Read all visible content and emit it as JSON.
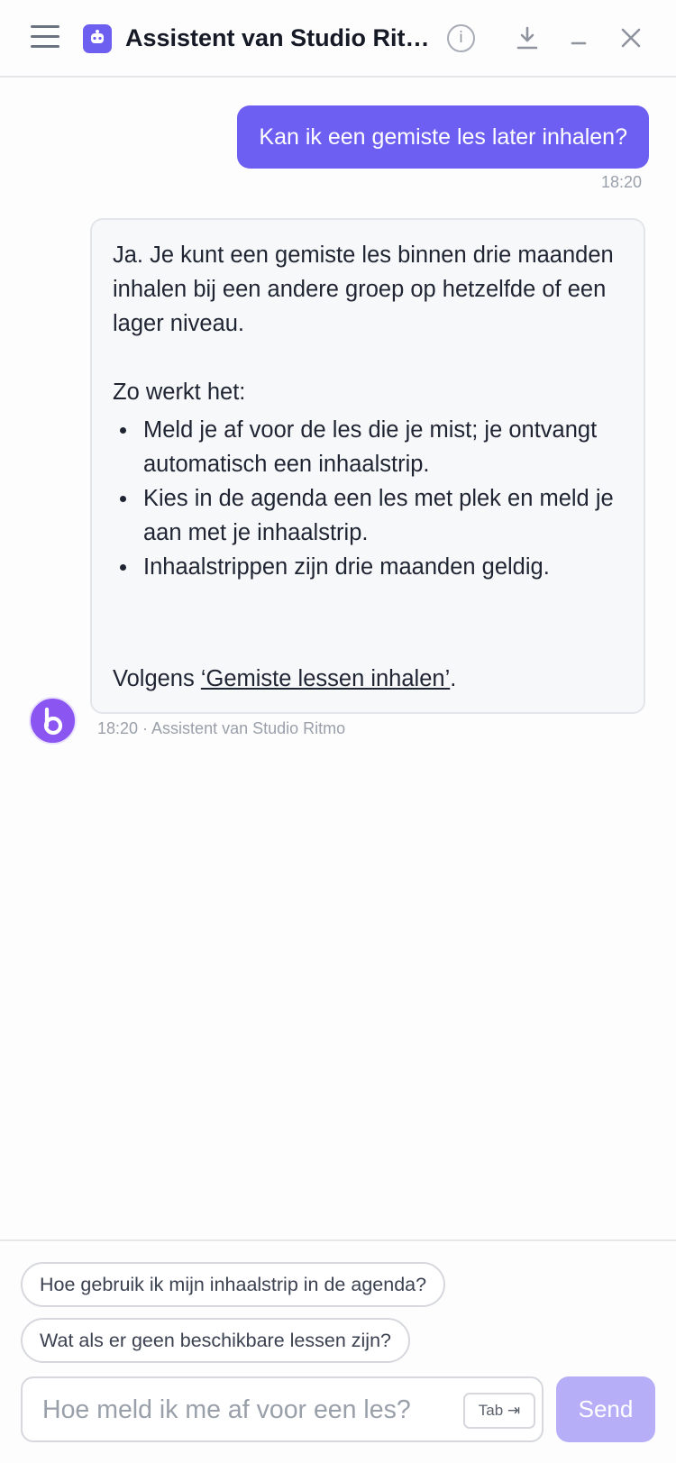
{
  "header": {
    "title": "Assistent van Studio Ritmo",
    "info_label": "i"
  },
  "conversation": {
    "user_message": {
      "text": "Kan ik een gemiste les later inhalen?",
      "time": "18:20"
    },
    "bot_message": {
      "intro": "Ja. Je kunt een gemiste les binnen drie maanden inhalen bij een andere groep op hetzelfde of een lager niveau.",
      "steps_heading": "Zo werkt het:",
      "steps": [
        "Meld je af voor de les die je mist; je ontvangt automatisch een inhaalstrip.",
        "Kies in de agenda een les met plek en meld je aan met je inhaalstrip.",
        "Inhaalstrippen zijn drie maanden geldig."
      ],
      "source_prefix": "Volgens ",
      "source_link": "‘Gemiste lessen inhalen’",
      "source_suffix": ".",
      "meta": "18:20 · Assistent van Studio Ritmo"
    }
  },
  "suggestions": [
    "Hoe gebruik ik mijn inhaalstrip in de agenda?",
    "Wat als er geen beschikbare lessen zijn?"
  ],
  "composer": {
    "placeholder": "Hoe meld ik me af voor een les?",
    "tab_hint": "Tab ⇥",
    "send_label": "Send"
  },
  "colors": {
    "accent": "#6e5ff3",
    "send_disabled": "#b6aef7",
    "avatar": "#8b55f2"
  }
}
